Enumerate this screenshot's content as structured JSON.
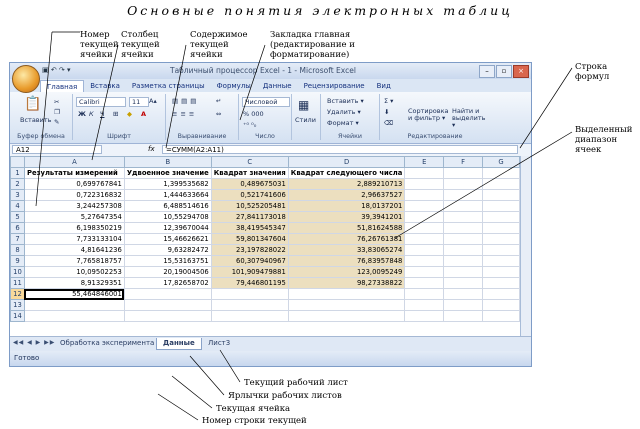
{
  "heading": "Основные понятия электронных таблиц",
  "annotations": {
    "row_number": "Номер текущей строки",
    "col": "Столбец текущей ячейки",
    "content": "Содержимое текущей ячейки",
    "cell_number": "Номер текущей ячейки",
    "home_tab": "Закладка главная (редактирование и форматирование)",
    "formula_bar": "Строка формул",
    "selected_range": "Выделенный диапазон ячеек",
    "current_sheet": "Текущий рабочий лист",
    "sheet_tabs": "Ярлычки рабочих листов",
    "current_cell": "Текущая ячейка",
    "current_row": "Номер строки текущей"
  },
  "window": {
    "title": "Табличный процессор Excel - 1 - Microsoft Excel",
    "qat": "▣ ↶ ↷ ▾"
  },
  "tabs": [
    "Главная",
    "Вставка",
    "Разметка страницы",
    "Формулы",
    "Данные",
    "Рецензирование",
    "Вид"
  ],
  "ribbon": {
    "paste": "Вставить",
    "font_name": "Calibri",
    "font_size": "11",
    "bold": "Ж",
    "italic": "К",
    "underline": "Ч",
    "number_format": "Числовой",
    "percent": "% 000",
    "styles": "Стили",
    "insert": "Вставить ▾",
    "delete": "Удалить ▾",
    "format": "Формат ▾",
    "sum": "Σ ▾",
    "sort": "Сортировка и фильтр ▾",
    "find": "Найти и выделить ▾",
    "groups": [
      "Буфер обмена",
      "Шрифт",
      "Выравнивание",
      "Число",
      "Ячейки",
      "Редактирование"
    ]
  },
  "formula_bar": {
    "name_box": "A12",
    "fx": "fx",
    "formula": "=СУММ(A2:A11)"
  },
  "columns": [
    "A",
    "B",
    "C",
    "D",
    "E",
    "F",
    "G"
  ],
  "header_row": [
    "Результаты измерений",
    "Удвоенное значение",
    "Квадрат значения",
    "Квадрат следующего числа"
  ],
  "rows": [
    [
      "0,699767841",
      "1,399535682",
      "0,489675031",
      "2,889210713"
    ],
    [
      "0,722316832",
      "1,444633664",
      "0,521741606",
      "2,96637527"
    ],
    [
      "3,244257308",
      "6,488514616",
      "10,525205481",
      "18,0137201"
    ],
    [
      "5,27647354",
      "10,55294708",
      "27,841173018",
      "39,3941201"
    ],
    [
      "6,198350219",
      "12,39670044",
      "38,419545347",
      "51,81624588"
    ],
    [
      "7,733133104",
      "15,46626621",
      "59,801347604",
      "76,26761381"
    ],
    [
      "4,81641236",
      "9,63282472",
      "23,197828022",
      "33,83065274"
    ],
    [
      "7,765818757",
      "15,53163751",
      "60,307940967",
      "76,83957848"
    ],
    [
      "10,09502253",
      "20,19004506",
      "101,909479881",
      "123,0095249"
    ],
    [
      "8,91329351",
      "17,82658702",
      "79,446801195",
      "98,27338822"
    ]
  ],
  "sum_value": "55,464846001",
  "sheets": [
    "Обработка эксперимента",
    "Данные",
    "Лист3"
  ],
  "status": "Готово"
}
